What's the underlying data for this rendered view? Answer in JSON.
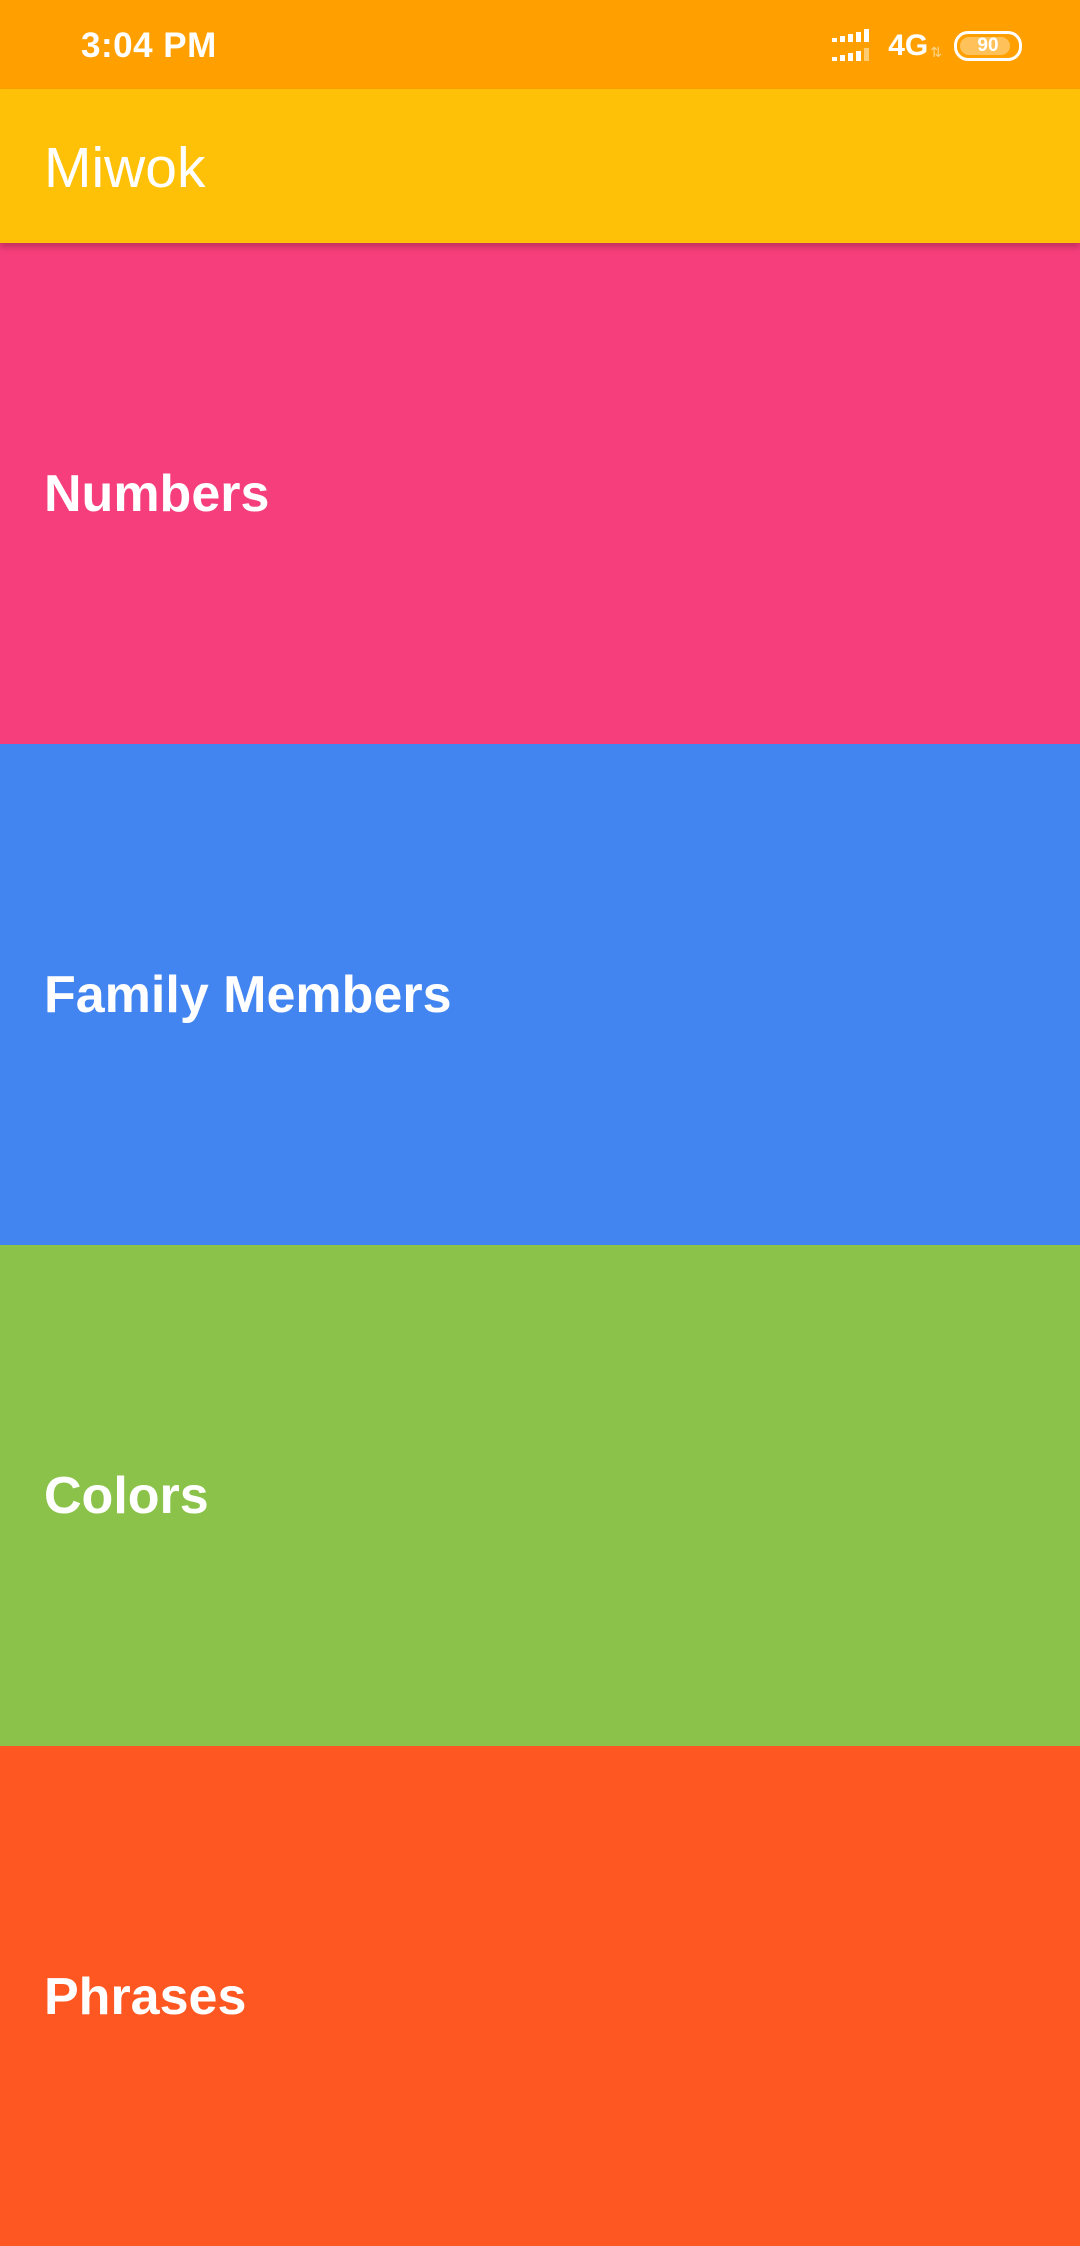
{
  "status_bar": {
    "time": "3:04 PM",
    "network": "4G",
    "battery": "90",
    "battery_fraction": 0.9,
    "signal_icon": "signal-bars-icon",
    "color": "#ffa000"
  },
  "app_bar": {
    "title": "Miwok",
    "color": "#ffc107"
  },
  "categories": [
    {
      "label": "Numbers",
      "color": "#f53e7b"
    },
    {
      "label": "Family Members",
      "color": "#4285f0"
    },
    {
      "label": "Colors",
      "color": "#8bc34a"
    },
    {
      "label": "Phrases",
      "color": "#ff5722"
    }
  ]
}
